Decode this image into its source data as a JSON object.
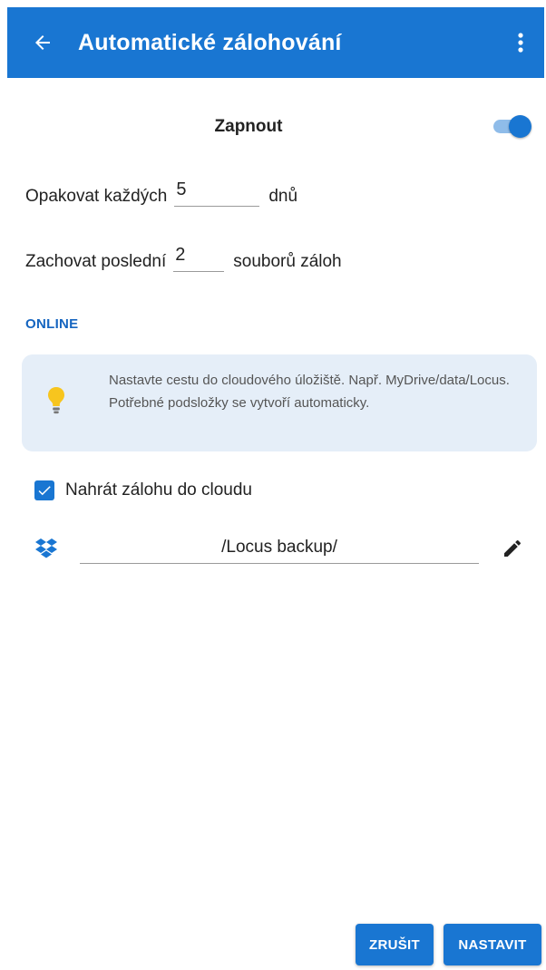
{
  "appbar": {
    "title": "Automatické zálohování",
    "back_icon": "arrow-left-icon",
    "menu_icon": "more-vertical-icon",
    "color": "#1976d2"
  },
  "enable": {
    "label": "Zapnout",
    "checked": true
  },
  "repeat": {
    "prefix": "Opakovat každých",
    "value": "5",
    "suffix": "dnů"
  },
  "keep": {
    "prefix": "Zachovat poslední",
    "value": "2",
    "suffix": "souborů záloh"
  },
  "online": {
    "section_title": "ONLINE",
    "info_text": "Nastavte cestu do cloudového úložiště. Např. MyDrive/data/Locus. Potřebné podsložky se vytvoří automaticky.",
    "info_icon": "lightbulb-icon",
    "upload_label": "Nahrát zálohu do cloudu",
    "upload_checked": true,
    "provider_icon": "dropbox-icon",
    "path": "/Locus backup/",
    "edit_icon": "pencil-icon"
  },
  "buttons": {
    "cancel": "ZRUŠIT",
    "ok": "NASTAVIT"
  }
}
